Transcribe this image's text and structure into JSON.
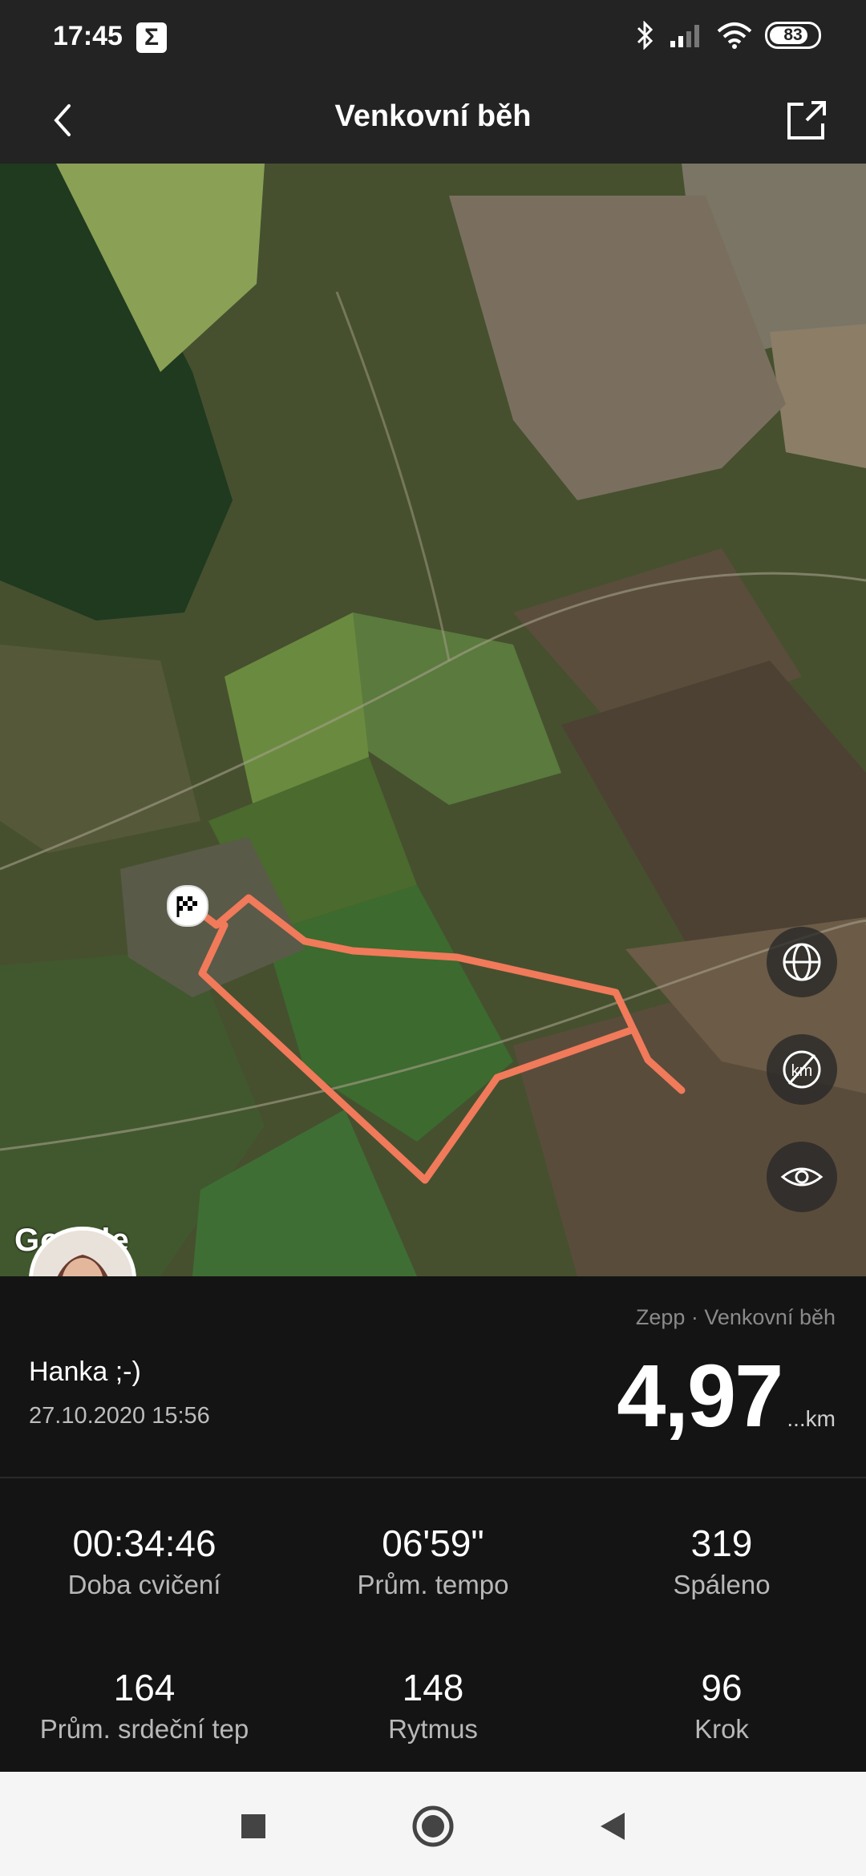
{
  "status_bar": {
    "time": "17:45",
    "sigma_icon": "Σ",
    "battery": "83",
    "battery_level": 0.83
  },
  "header": {
    "title": "Venkovní běh",
    "back_icon": "chevron-left-icon",
    "share_icon": "share-icon"
  },
  "map": {
    "attribution": "Google",
    "route_color": "#f07a5a",
    "buttons": [
      "globe-icon",
      "distance-markers-off-icon",
      "eye-icon"
    ]
  },
  "summary": {
    "user_name": "Hanka ;-)",
    "date": "27.10.2020 15:56",
    "source": "Zepp · Venkovní běh",
    "distance": "4,97",
    "distance_unit": "...km"
  },
  "stats": [
    {
      "value": "00:34:46",
      "label": "Doba cvičení"
    },
    {
      "value": "06'59\"",
      "label": "Prům. tempo"
    },
    {
      "value": "319",
      "label": "Spáleno"
    },
    {
      "value": "164",
      "label": "Prům. srdeční tep"
    },
    {
      "value": "148",
      "label": "Rytmus"
    },
    {
      "value": "96",
      "label": "Krok"
    }
  ],
  "navbar": [
    "recents-square-icon",
    "home-circle-icon",
    "back-triangle-icon"
  ]
}
